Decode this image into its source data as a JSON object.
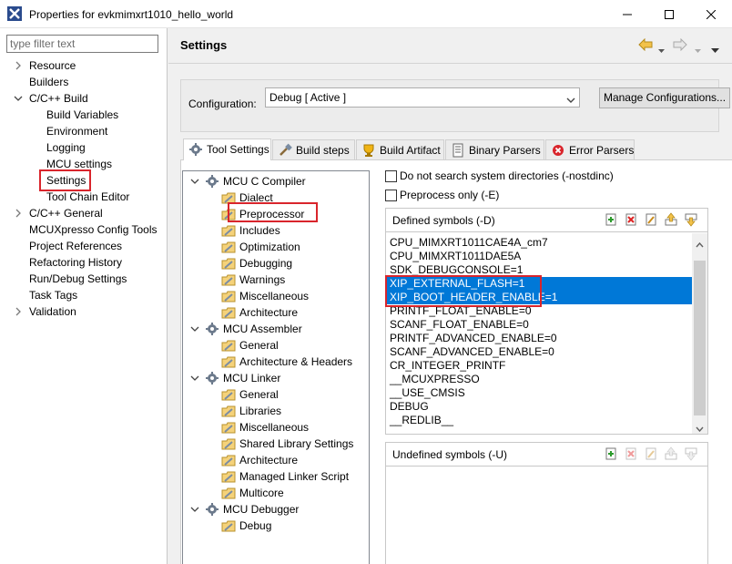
{
  "window": {
    "title": "Properties for evkmimxrt1010_hello_world"
  },
  "filter": {
    "placeholder": "type filter text",
    "value": ""
  },
  "nav": {
    "items": [
      {
        "label": "Resource",
        "expander": "collapsed"
      },
      {
        "label": "Builders",
        "expander": "none"
      },
      {
        "label": "C/C++ Build",
        "expander": "expanded"
      },
      {
        "label": "Build Variables",
        "expander": "none"
      },
      {
        "label": "Environment",
        "expander": "none"
      },
      {
        "label": "Logging",
        "expander": "none"
      },
      {
        "label": "MCU settings",
        "expander": "none"
      },
      {
        "label": "Settings",
        "expander": "none",
        "selected": true
      },
      {
        "label": "Tool Chain Editor",
        "expander": "none"
      },
      {
        "label": "C/C++ General",
        "expander": "collapsed"
      },
      {
        "label": "MCUXpresso Config Tools",
        "expander": "none"
      },
      {
        "label": "Project References",
        "expander": "none"
      },
      {
        "label": "Refactoring History",
        "expander": "none"
      },
      {
        "label": "Run/Debug Settings",
        "expander": "none"
      },
      {
        "label": "Task Tags",
        "expander": "none"
      },
      {
        "label": "Validation",
        "expander": "collapsed"
      }
    ]
  },
  "page": {
    "title": "Settings"
  },
  "config": {
    "label": "Configuration:",
    "value": "Debug  [ Active ]",
    "manage_label": "Manage Configurations..."
  },
  "tabs": [
    {
      "label": "Tool Settings",
      "icon": "tool-settings-icon",
      "active": true
    },
    {
      "label": "Build steps",
      "icon": "build-steps-icon"
    },
    {
      "label": "Build Artifact",
      "icon": "build-artifact-icon"
    },
    {
      "label": "Binary Parsers",
      "icon": "binary-parsers-icon"
    },
    {
      "label": "Error Parsers",
      "icon": "error-parsers-icon"
    }
  ],
  "tool_tree": [
    {
      "label": "MCU C Compiler",
      "type": "tool"
    },
    {
      "label": "Dialect",
      "type": "option"
    },
    {
      "label": "Preprocessor",
      "type": "option",
      "selected": true
    },
    {
      "label": "Includes",
      "type": "option"
    },
    {
      "label": "Optimization",
      "type": "option"
    },
    {
      "label": "Debugging",
      "type": "option"
    },
    {
      "label": "Warnings",
      "type": "option"
    },
    {
      "label": "Miscellaneous",
      "type": "option"
    },
    {
      "label": "Architecture",
      "type": "option"
    },
    {
      "label": "MCU Assembler",
      "type": "tool"
    },
    {
      "label": "General",
      "type": "option"
    },
    {
      "label": "Architecture & Headers",
      "type": "option"
    },
    {
      "label": "MCU Linker",
      "type": "tool"
    },
    {
      "label": "General",
      "type": "option"
    },
    {
      "label": "Libraries",
      "type": "option"
    },
    {
      "label": "Miscellaneous",
      "type": "option"
    },
    {
      "label": "Shared Library Settings",
      "type": "option"
    },
    {
      "label": "Architecture",
      "type": "option"
    },
    {
      "label": "Managed Linker Script",
      "type": "option"
    },
    {
      "label": "Multicore",
      "type": "option"
    },
    {
      "label": "MCU Debugger",
      "type": "tool"
    },
    {
      "label": "Debug",
      "type": "option"
    }
  ],
  "options": {
    "nostdinc_label": "Do not search system directories (-nostdinc)",
    "nostdinc_checked": false,
    "preprocess_label": "Preprocess only (-E)",
    "preprocess_checked": false
  },
  "defined": {
    "header": "Defined symbols (-D)",
    "symbols": [
      {
        "text": "CPU_MIMXRT1011CAE4A_cm7"
      },
      {
        "text": "CPU_MIMXRT1011DAE5A"
      },
      {
        "text": "SDK_DEBUGCONSOLE=1"
      },
      {
        "text": "XIP_EXTERNAL_FLASH=1",
        "selected": true
      },
      {
        "text": "XIP_BOOT_HEADER_ENABLE=1",
        "selected": true
      },
      {
        "text": "PRINTF_FLOAT_ENABLE=0"
      },
      {
        "text": "SCANF_FLOAT_ENABLE=0"
      },
      {
        "text": "PRINTF_ADVANCED_ENABLE=0"
      },
      {
        "text": "SCANF_ADVANCED_ENABLE=0"
      },
      {
        "text": "CR_INTEGER_PRINTF"
      },
      {
        "text": "__MCUXPRESSO"
      },
      {
        "text": "__USE_CMSIS"
      },
      {
        "text": "DEBUG"
      },
      {
        "text": "__REDLIB__"
      }
    ]
  },
  "undefined": {
    "header": "Undefined symbols (-U)",
    "symbols": []
  },
  "colors": {
    "selection": "#0078d7",
    "highlight_box": "#d9252c"
  }
}
